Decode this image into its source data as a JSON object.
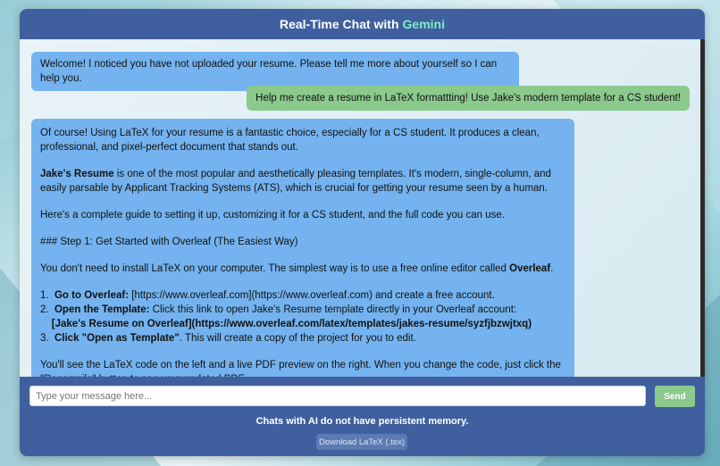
{
  "header": {
    "title_prefix": "Real-Time Chat with",
    "title_accent": "Gemini"
  },
  "messages": {
    "welcome": "Welcome! I noticed you have not uploaded your resume. Please tell me more about yourself so I can help you.",
    "user": "Help me create a resume in LaTeX formattting! Use Jake's modern template for a CS student!",
    "reply": {
      "p1": "Of course! Using LaTeX for your resume is a fantastic choice, especially for a CS student. It produces a clean, professional, and pixel-perfect document that stands out.",
      "p2_bold": "Jake's Resume",
      "p2_rest": " is one of the most popular and aesthetically pleasing templates. It's modern, single-column, and easily parsable by Applicant Tracking Systems (ATS), which is crucial for getting your resume seen by a human.",
      "p3": "Here's a complete guide to setting it up, customizing it for a CS student, and the full code you can use.",
      "p4": "### Step 1: Get Started with Overleaf (The Easiest Way)",
      "p5_start": "You don't need to install LaTeX on your computer. The simplest way is to use a free online editor called ",
      "p5_bold": "Overleaf",
      "p5_end": ".",
      "li1_num": "1.",
      "li1_bold": "Go to Overleaf:",
      "li1_rest": " [https://www.overleaf.com](https://www.overleaf.com) and create a free account.",
      "li2_num": "2.",
      "li2_bold": "Open the Template:",
      "li2_rest": " Click this link to open Jake's Resume template directly in your Overleaf account:",
      "li2_link": "[Jake's Resume on Overleaf](https://www.overleaf.com/latex/templates/jakes-resume/syzfjbzwjtxq)",
      "li3_num": "3.",
      "li3_bold": "Click \"Open as Template\"",
      "li3_rest": ". This will create a copy of the project for you to edit.",
      "p6": "You'll see the LaTeX code on the left and a live PDF preview on the right. When you change the code, just click the \"Recompile\" button to see your updated PDF."
    }
  },
  "input": {
    "placeholder": "Type your message here..."
  },
  "send_label": "Send",
  "memory_note": "Chats with AI do not have persistent memory.",
  "download_label": "Download LaTeX (.tex)",
  "colors": {
    "header": "#3f5f9e",
    "accent": "#7ff0c6",
    "bot_bubble": "#74b3ef",
    "user_bubble": "#8bc98d"
  }
}
